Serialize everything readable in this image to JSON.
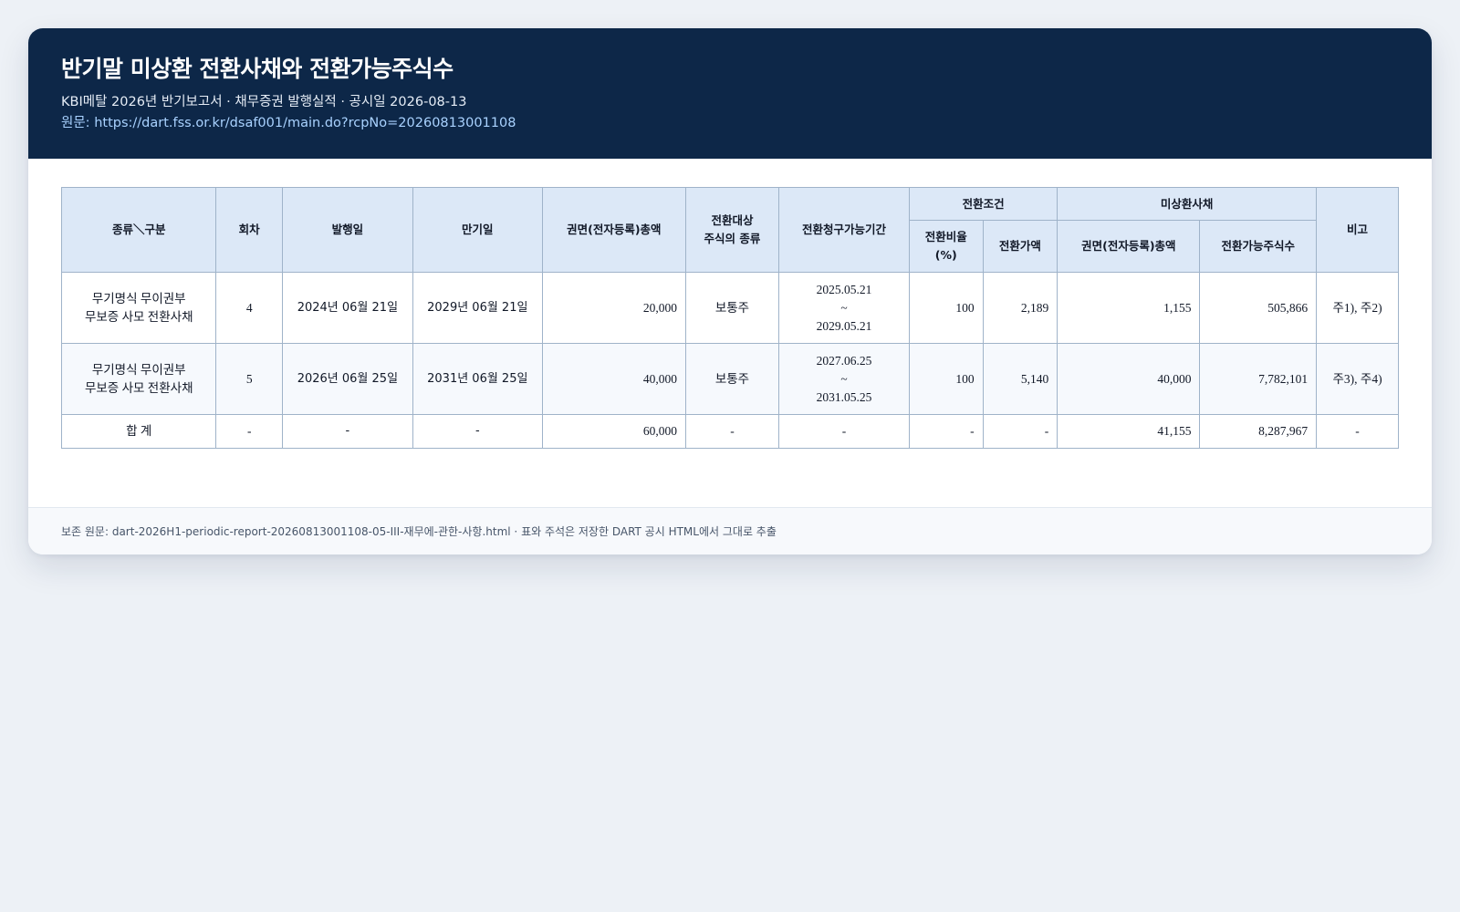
{
  "header": {
    "title": "반기말 미상환 전환사채와 전환가능주식수",
    "subtitle": "KBI메탈 2026년 반기보고서 · 채무증권 발행실적 · 공시일 2026-08-13",
    "source_prefix": "원문: ",
    "source_url": "https://dart.fss.or.kr/dsaf001/main.do?rcpNo=20260813001108"
  },
  "table": {
    "headers": {
      "type": "종류＼구분",
      "round": "회차",
      "issue_date": "발행일",
      "maturity": "만기일",
      "face_total": "권면(전자등록)총액",
      "target_stock_line1": "전환대상",
      "target_stock_line2": "주식의 종류",
      "period": "전환청구가능기간",
      "conditions_group": "전환조건",
      "ratio_line1": "전환비율",
      "ratio_line2": "(%)",
      "price": "전환가액",
      "unredeemed_group": "미상환사채",
      "unredeemed_face": "권면(전자등록)총액",
      "convertible_shares": "전환가능주식수",
      "note": "비고"
    },
    "rows": [
      {
        "type_line1": "무기명식 무이권부",
        "type_line2": "무보증 사모 전환사채",
        "round": "4",
        "issue_date": "2024년 06월 21일",
        "maturity": "2029년 06월 21일",
        "face_total": "20,000",
        "target_stock": "보통주",
        "period_start": "2025.05.21",
        "period_sep": "~",
        "period_end": "2029.05.21",
        "ratio": "100",
        "price": "2,189",
        "unredeemed_face": "1,155",
        "convertible_shares": "505,866",
        "note": "주1), 주2)"
      },
      {
        "type_line1": "무기명식 무이권부",
        "type_line2": "무보증 사모 전환사채",
        "round": "5",
        "issue_date": "2026년 06월 25일",
        "maturity": "2031년 06월 25일",
        "face_total": "40,000",
        "target_stock": "보통주",
        "period_start": "2027.06.25",
        "period_sep": "~",
        "period_end": "2031.05.25",
        "ratio": "100",
        "price": "5,140",
        "unredeemed_face": "40,000",
        "convertible_shares": "7,782,101",
        "note": "주3), 주4)"
      }
    ],
    "total": {
      "label": "합 계",
      "round": "-",
      "issue_date": "-",
      "maturity": "-",
      "face_total": "60,000",
      "target_stock": "-",
      "period": "-",
      "ratio": "-",
      "price": "-",
      "unredeemed_face": "41,155",
      "convertible_shares": "8,287,967",
      "note": "-"
    }
  },
  "footer": {
    "text": "보존 원문: dart-2026H1-periodic-report-20260813001108-05-III-재무에-관한-사항.html · 표와 주석은 저장한 DART 공시 HTML에서 그대로 추출"
  }
}
